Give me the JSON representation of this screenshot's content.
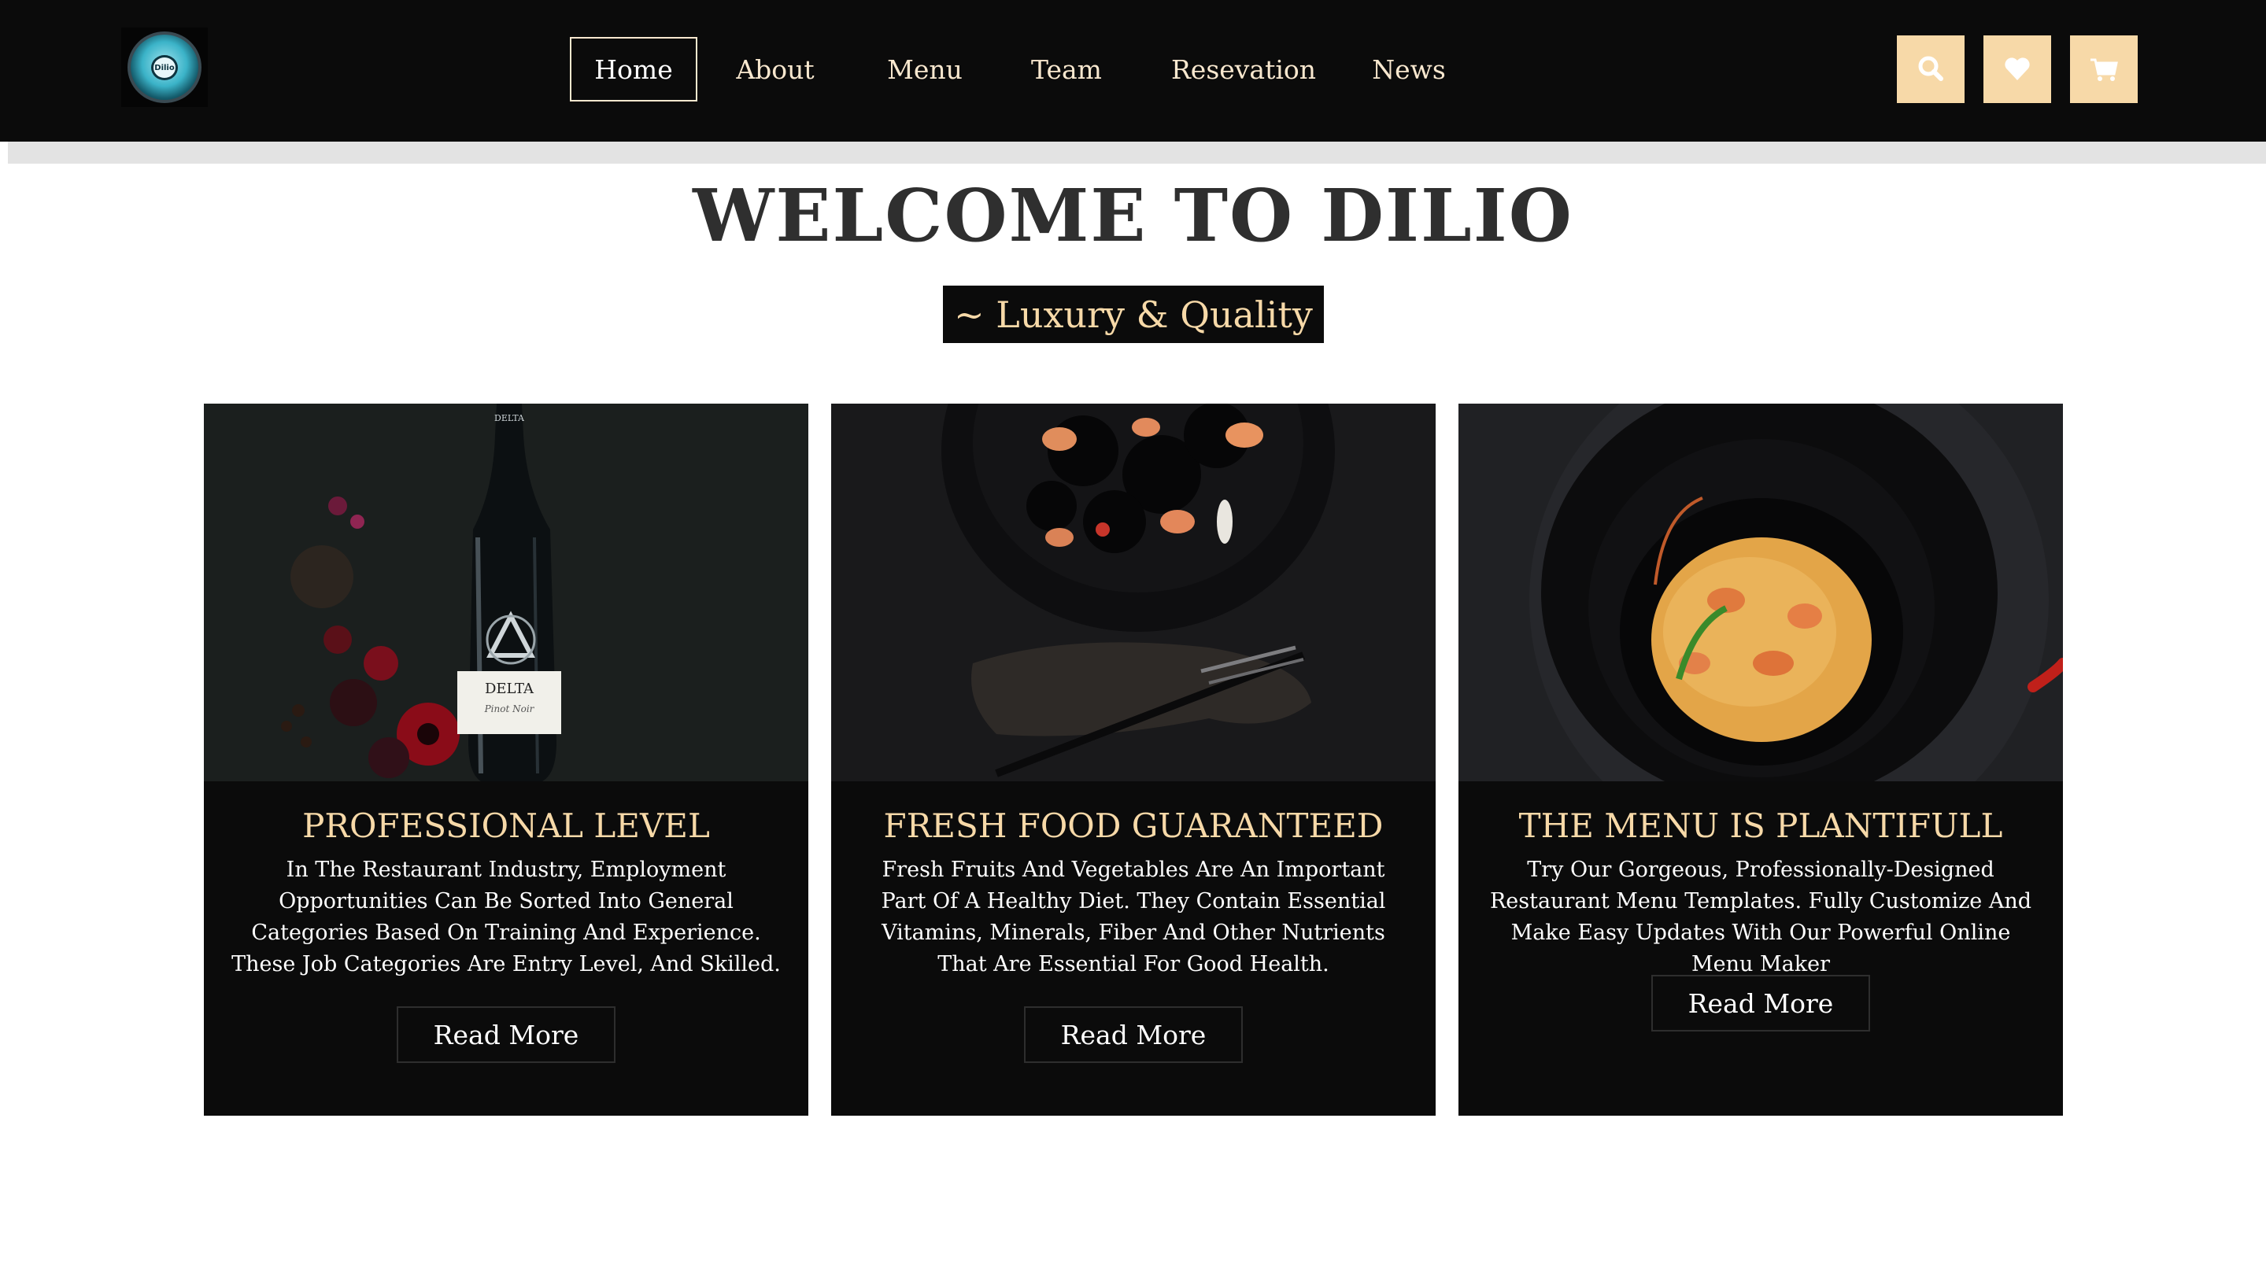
{
  "header": {
    "logo_alt": "Dilio",
    "logo_text": "Dilio",
    "nav": [
      {
        "label": "Home",
        "active": true
      },
      {
        "label": "About",
        "active": false
      },
      {
        "label": "Menu",
        "active": false
      },
      {
        "label": "Team",
        "active": false
      },
      {
        "label": "Resevation",
        "active": false
      },
      {
        "label": "News",
        "active": false
      }
    ],
    "icons": [
      "search-icon",
      "heart-icon",
      "cart-icon"
    ]
  },
  "hero": {
    "title": "WELCOME TO DILIO",
    "tagline": "~ Luxury & Quality"
  },
  "cards": [
    {
      "image": "wine-bottle-image",
      "title": "PROFESSIONAL LEVEL",
      "text": "In The Restaurant Industry, Employment Opportunities Can Be Sorted Into General Categories Based On Training And Experience. These Job Categories Are Entry Level, And Skilled.",
      "button": "Read More"
    },
    {
      "image": "black-pasta-image",
      "title": "FRESH FOOD GUARANTEED",
      "text": "Fresh Fruits And Vegetables Are An Important Part Of A Healthy Diet. They Contain Essential Vitamins, Minerals, Fiber And Other Nutrients That Are Essential For Good Health.",
      "button": "Read More"
    },
    {
      "image": "curry-bowl-image",
      "title": "THE MENU IS PLANTIFULL",
      "text": "Try Our Gorgeous, Professionally-Designed Restaurant Menu Templates. Fully Customize And Make Easy Updates With Our Powerful Online Menu Maker",
      "button": "Read More"
    }
  ],
  "image_text": {
    "bottle_label_brand": "DELTA",
    "bottle_label_variety": "Pinot Noir",
    "bottle_neck": "DELTA"
  },
  "colors": {
    "header_bg": "#0b0b0b",
    "accent": "#f7d9a8",
    "nav_text": "#f9e8cf",
    "title": "#2f2f2f"
  }
}
